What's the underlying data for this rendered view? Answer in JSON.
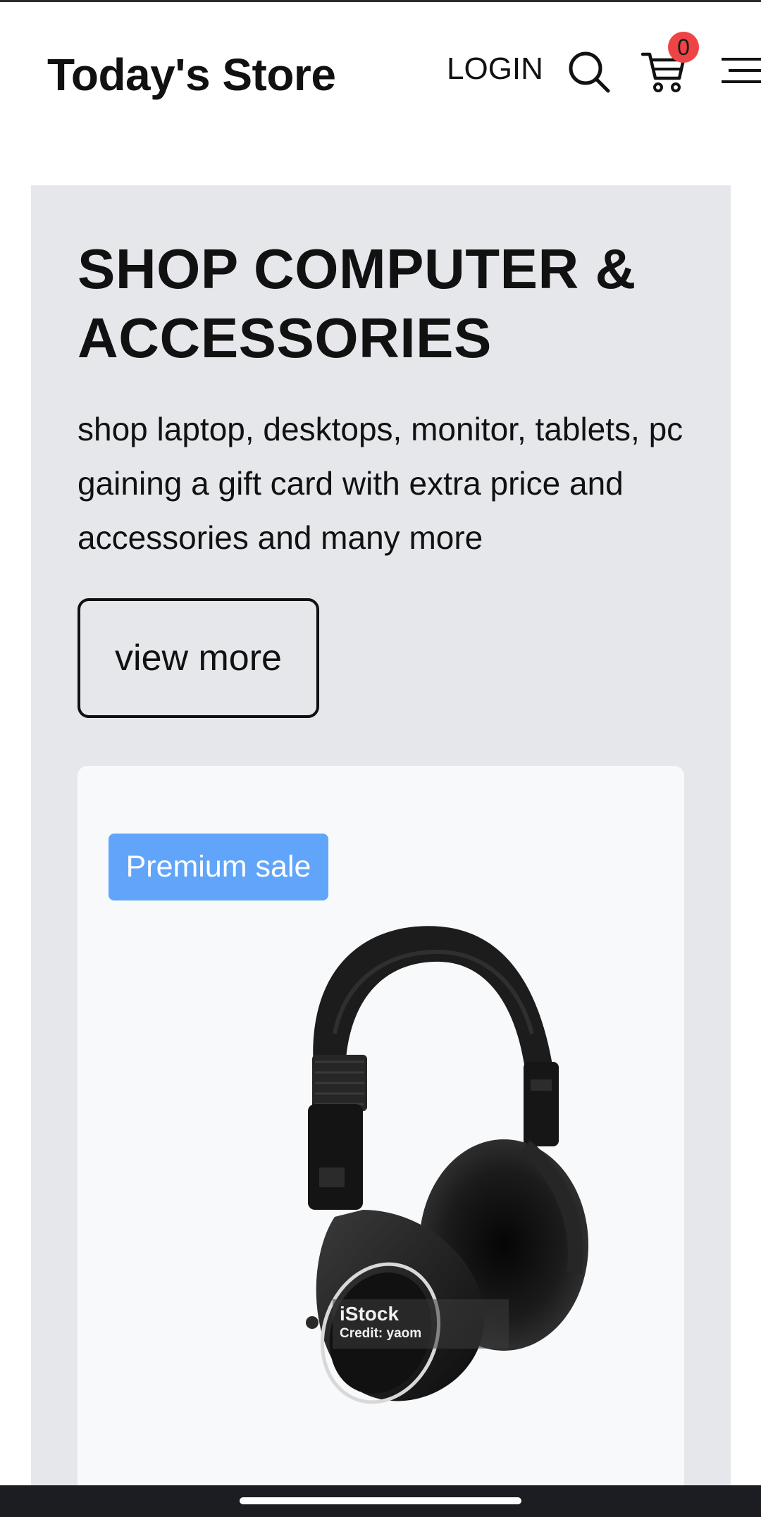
{
  "header": {
    "brand": "Today's Store",
    "login_label": "LOGIN",
    "cart_count": "0",
    "icons": [
      "search-icon",
      "cart-icon",
      "menu-icon"
    ]
  },
  "hero": {
    "title": "SHOP COMPUTER & ACCESSORIES",
    "description": "shop laptop, desktops, monitor, tablets, pc gaining a gift card with extra price and accessories and many more",
    "cta_label": "view more"
  },
  "product_card": {
    "badge": "Premium sale",
    "image_subject": "black over-ear headphones",
    "watermark_brand": "iStock",
    "watermark_credit": "Credit: yaom"
  },
  "colors": {
    "hero_background": "#e5e7eb",
    "card_background": "#f8f9fb",
    "badge_background": "#60a5fa",
    "cart_badge": "#ef4444",
    "system_bar": "#1c1d22"
  }
}
